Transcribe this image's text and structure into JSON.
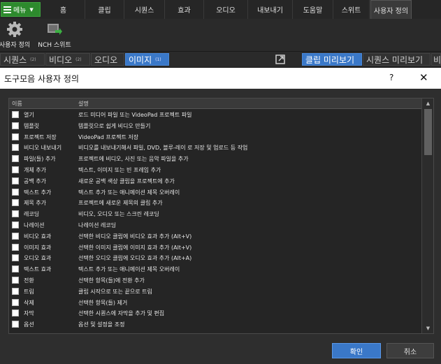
{
  "menubar": {
    "menu_label": "메뉴",
    "tabs": [
      "홈",
      "클립",
      "시퀀스",
      "효과",
      "오디오",
      "내보내기",
      "도움말",
      "스위트",
      "사용자 정의"
    ]
  },
  "toolbar": {
    "items": [
      {
        "label": "사용자 정의",
        "icon": "gear-icon"
      },
      {
        "label": "NCH 스위트",
        "icon": "nch-suite-icon"
      }
    ]
  },
  "panelbar": {
    "tabs": [
      {
        "label": "시퀀스",
        "badge": "(2)"
      },
      {
        "label": "비디오",
        "badge": "(2)"
      },
      {
        "label": "오디오",
        "badge": ""
      },
      {
        "label": "이미지",
        "badge": "(1)"
      }
    ],
    "right_tabs": [
      {
        "label": "클립 미리보기"
      },
      {
        "label": "시퀀스 미리보기"
      },
      {
        "label": "비"
      }
    ]
  },
  "dialog": {
    "title": "도구모음 사용자 정의",
    "help": "?",
    "close": "✕",
    "columns": {
      "name": "이름",
      "desc": "설명"
    },
    "rows": [
      {
        "name": "열기",
        "desc": "로드 미디어 파일 또는 VideoPad 프로젝트 파일"
      },
      {
        "name": "템플릿",
        "desc": "템플릿으로 쉽게 비디오 만들기"
      },
      {
        "name": "프로젝트 저장",
        "desc": "VideoPad 프로젝트 저장"
      },
      {
        "name": "비디오 내보내기",
        "desc": "비디오를 내보내기해서 파일, DVD, 블루-레이 로 저장 및 업로드 등 작업"
      },
      {
        "name": "파일(들) 추가",
        "desc": "프로젝트에 비디오, 사진 또는 음악 파일을 추가"
      },
      {
        "name": "개체 추가",
        "desc": "텍스트, 이미지 또는 빈 프레임 추가"
      },
      {
        "name": "공백 추가",
        "desc": "새로운 공백 색상 클립을 프로젝트에 추가"
      },
      {
        "name": "텍스트 추가",
        "desc": "텍스트 추가 또는 애니메이션 제목 오버레이"
      },
      {
        "name": "제목 추가",
        "desc": "프로젝트에 새로운 제목의 클립 추가"
      },
      {
        "name": "레코딩",
        "desc": "비디오, 오디오 또는 스크린 레코딩"
      },
      {
        "name": "나레이션",
        "desc": "나레이션 레코딩"
      },
      {
        "name": "비디오 효과",
        "desc": "선택한 비디오 클립에 비디오 효과 추가 (Alt+V)"
      },
      {
        "name": "이미지 효과",
        "desc": "선택한 이미지 클립에 이미지 효과 추가 (Alt+V)"
      },
      {
        "name": "오디오 효과",
        "desc": "선택한 오디오 클립에 오디오 효과 추가 (Alt+A)"
      },
      {
        "name": "텍스트 효과",
        "desc": "텍스트 추가 또는 애니메이션 제목 오버레이"
      },
      {
        "name": "전환",
        "desc": "선택한 항목(들)에 전환 추가"
      },
      {
        "name": "트림",
        "desc": "클립 시작으로 또는 끝으로 트림"
      },
      {
        "name": "삭제",
        "desc": "선택한 항목(들) 제거"
      },
      {
        "name": "자막",
        "desc": "선택한 시퀀스에 자막을 추가 및 편집"
      },
      {
        "name": "옵션",
        "desc": "옵션 및 설정을 조정"
      }
    ],
    "ok_label": "확인",
    "cancel_label": "취소"
  },
  "colors": {
    "accent": "#3a78c8",
    "menu_green": "#2d8a2d"
  }
}
